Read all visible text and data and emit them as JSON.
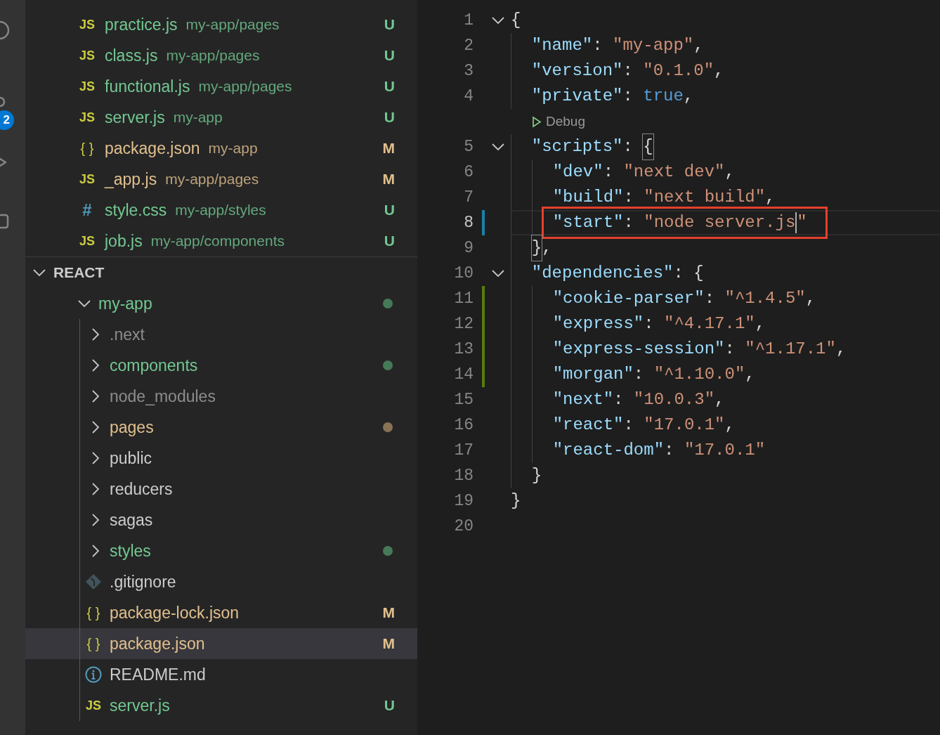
{
  "activity_bar": {
    "badge": "2"
  },
  "open_editors": [
    {
      "kind": "js",
      "icon": "JS",
      "name": "practice.js",
      "path": "my-app/pages",
      "status": "U",
      "color": "#73c991"
    },
    {
      "kind": "js",
      "icon": "JS",
      "name": "class.js",
      "path": "my-app/pages",
      "status": "U",
      "color": "#73c991"
    },
    {
      "kind": "js",
      "icon": "JS",
      "name": "functional.js",
      "path": "my-app/pages",
      "status": "U",
      "color": "#73c991"
    },
    {
      "kind": "js",
      "icon": "JS",
      "name": "server.js",
      "path": "my-app",
      "status": "U",
      "color": "#73c991"
    },
    {
      "kind": "json",
      "icon": "{ }",
      "name": "package.json",
      "path": "my-app",
      "status": "M",
      "color": "#e2c08d"
    },
    {
      "kind": "js",
      "icon": "JS",
      "name": "_app.js",
      "path": "my-app/pages",
      "status": "M",
      "color": "#e2c08d"
    },
    {
      "kind": "css",
      "icon": "#",
      "name": "style.css",
      "path": "my-app/styles",
      "status": "U",
      "color": "#73c991"
    },
    {
      "kind": "js",
      "icon": "JS",
      "name": "job.js",
      "path": "my-app/components",
      "status": "U",
      "color": "#73c991"
    }
  ],
  "explorer": {
    "title": "REACT",
    "expanded": true,
    "tree": [
      {
        "kind": "folder",
        "name": "my-app",
        "expanded": true,
        "dot": true,
        "selected": false,
        "color": "#73c991",
        "children": [
          {
            "kind": "folder",
            "name": ".next",
            "expanded": false,
            "dot": false,
            "selected": false,
            "color": "#8c8c8c"
          },
          {
            "kind": "folder",
            "name": "components",
            "expanded": false,
            "dot": true,
            "selected": false,
            "color": "#73c991"
          },
          {
            "kind": "folder",
            "name": "node_modules",
            "expanded": false,
            "dot": false,
            "selected": false,
            "color": "#8c8c8c"
          },
          {
            "kind": "folder",
            "name": "pages",
            "expanded": false,
            "dot": true,
            "selected": false,
            "color": "#e2c08d"
          },
          {
            "kind": "folder",
            "name": "public",
            "expanded": false,
            "dot": false,
            "selected": false,
            "color": "#cccccc"
          },
          {
            "kind": "folder",
            "name": "reducers",
            "expanded": false,
            "dot": false,
            "selected": false,
            "color": "#cccccc"
          },
          {
            "kind": "folder",
            "name": "sagas",
            "expanded": false,
            "dot": false,
            "selected": false,
            "color": "#cccccc"
          },
          {
            "kind": "folder",
            "name": "styles",
            "expanded": false,
            "dot": true,
            "selected": false,
            "color": "#73c991"
          },
          {
            "kind": "git",
            "name": ".gitignore",
            "selected": false,
            "color": "#cccccc"
          },
          {
            "kind": "json",
            "icon": "{ }",
            "name": "package-lock.json",
            "status": "M",
            "selected": false,
            "color": "#e2c08d"
          },
          {
            "kind": "json",
            "icon": "{ }",
            "name": "package.json",
            "status": "M",
            "selected": true,
            "color": "#e2c08d"
          },
          {
            "kind": "info",
            "name": "README.md",
            "selected": false,
            "color": "#cccccc"
          },
          {
            "kind": "js",
            "icon": "JS",
            "name": "server.js",
            "status": "U",
            "selected": false,
            "color": "#73c991"
          }
        ]
      }
    ]
  },
  "editor": {
    "lines": [
      {
        "number": "1",
        "fold": true,
        "tokens": [
          {
            "kind": "punct",
            "text": "{"
          }
        ]
      },
      {
        "number": "2",
        "tokens": [
          {
            "kind": "key",
            "text": "  \"name\""
          },
          {
            "kind": "punct",
            "text": ": "
          },
          {
            "kind": "string",
            "text": "\"my-app\""
          },
          {
            "kind": "punct",
            "text": ","
          }
        ]
      },
      {
        "number": "3",
        "tokens": [
          {
            "kind": "key",
            "text": "  \"version\""
          },
          {
            "kind": "punct",
            "text": ": "
          },
          {
            "kind": "string",
            "text": "\"0.1.0\""
          },
          {
            "kind": "punct",
            "text": ","
          }
        ]
      },
      {
        "number": "4",
        "tokens": [
          {
            "kind": "key",
            "text": "  \"private\""
          },
          {
            "kind": "punct",
            "text": ": "
          },
          {
            "kind": "bool",
            "text": "true"
          },
          {
            "kind": "punct",
            "text": ","
          }
        ]
      },
      {
        "number": "5",
        "fold": true,
        "codelens": "Debug",
        "tokens": [
          {
            "kind": "key",
            "text": "  \"scripts\""
          },
          {
            "kind": "punct",
            "text": ": "
          },
          {
            "kind": "bracket",
            "text": "{"
          }
        ]
      },
      {
        "number": "6",
        "tokens": [
          {
            "kind": "key",
            "text": "    \"dev\""
          },
          {
            "kind": "punct",
            "text": ": "
          },
          {
            "kind": "string",
            "text": "\"next dev\""
          },
          {
            "kind": "punct",
            "text": ","
          }
        ]
      },
      {
        "number": "7",
        "tokens": [
          {
            "kind": "key",
            "text": "    \"build\""
          },
          {
            "kind": "punct",
            "text": ": "
          },
          {
            "kind": "string",
            "text": "\"next build\""
          },
          {
            "kind": "punct",
            "text": ","
          }
        ]
      },
      {
        "number": "8",
        "modified": true,
        "current": true,
        "boxed": true,
        "tokens": [
          {
            "kind": "key",
            "text": "    \"start\""
          },
          {
            "kind": "punct",
            "text": ": "
          },
          {
            "kind": "string",
            "text": "\"node server.js"
          },
          {
            "kind": "cursor"
          },
          {
            "kind": "string",
            "text": "\""
          }
        ]
      },
      {
        "number": "9",
        "tokens": [
          {
            "kind": "bracket",
            "text": "  }"
          },
          {
            "kind": "punct",
            "text": ","
          }
        ]
      },
      {
        "number": "10",
        "fold": true,
        "tokens": [
          {
            "kind": "key",
            "text": "  \"dependencies\""
          },
          {
            "kind": "punct",
            "text": ": {"
          }
        ]
      },
      {
        "number": "11",
        "added": true,
        "tokens": [
          {
            "kind": "key",
            "text": "    \"cookie-parser\""
          },
          {
            "kind": "punct",
            "text": ": "
          },
          {
            "kind": "string",
            "text": "\"^1.4.5\""
          },
          {
            "kind": "punct",
            "text": ","
          }
        ]
      },
      {
        "number": "12",
        "added": true,
        "tokens": [
          {
            "kind": "key",
            "text": "    \"express\""
          },
          {
            "kind": "punct",
            "text": ": "
          },
          {
            "kind": "string",
            "text": "\"^4.17.1\""
          },
          {
            "kind": "punct",
            "text": ","
          }
        ]
      },
      {
        "number": "13",
        "added": true,
        "tokens": [
          {
            "kind": "key",
            "text": "    \"express-session\""
          },
          {
            "kind": "punct",
            "text": ": "
          },
          {
            "kind": "string",
            "text": "\"^1.17.1\""
          },
          {
            "kind": "punct",
            "text": ","
          }
        ]
      },
      {
        "number": "14",
        "added": true,
        "tokens": [
          {
            "kind": "key",
            "text": "    \"morgan\""
          },
          {
            "kind": "punct",
            "text": ": "
          },
          {
            "kind": "string",
            "text": "\"^1.10.0\""
          },
          {
            "kind": "punct",
            "text": ","
          }
        ]
      },
      {
        "number": "15",
        "tokens": [
          {
            "kind": "key",
            "text": "    \"next\""
          },
          {
            "kind": "punct",
            "text": ": "
          },
          {
            "kind": "string",
            "text": "\"10.0.3\""
          },
          {
            "kind": "punct",
            "text": ","
          }
        ]
      },
      {
        "number": "16",
        "tokens": [
          {
            "kind": "key",
            "text": "    \"react\""
          },
          {
            "kind": "punct",
            "text": ": "
          },
          {
            "kind": "string",
            "text": "\"17.0.1\""
          },
          {
            "kind": "punct",
            "text": ","
          }
        ]
      },
      {
        "number": "17",
        "tokens": [
          {
            "kind": "key",
            "text": "    \"react-dom\""
          },
          {
            "kind": "punct",
            "text": ": "
          },
          {
            "kind": "string",
            "text": "\"17.0.1\""
          }
        ]
      },
      {
        "number": "18",
        "tokens": [
          {
            "kind": "punct",
            "text": "  }"
          }
        ]
      },
      {
        "number": "19",
        "tokens": [
          {
            "kind": "punct",
            "text": "}"
          }
        ]
      },
      {
        "number": "20"
      }
    ]
  }
}
